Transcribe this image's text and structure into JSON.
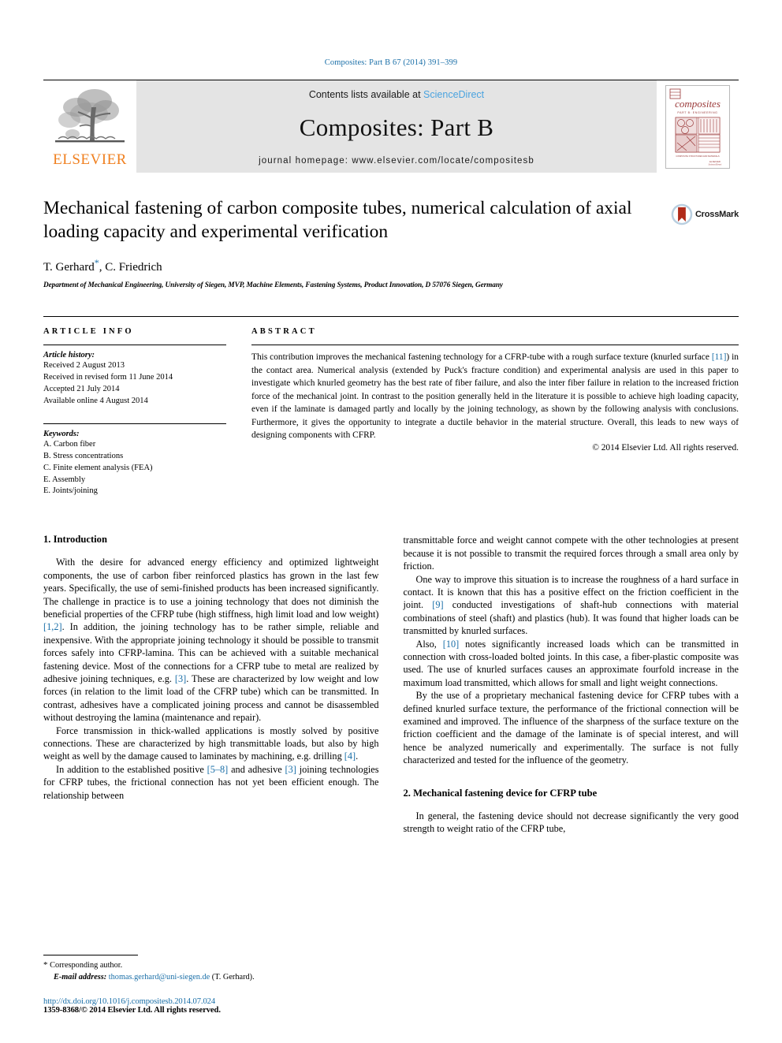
{
  "running_head": "Composites: Part B 67 (2014) 391–399",
  "masthead": {
    "publisher_name": "ELSEVIER",
    "contents_prefix": "Contents lists available at",
    "contents_link": "ScienceDirect",
    "journal_title": "Composites: Part B",
    "journal_homepage": "journal homepage: www.elsevier.com/locate/compositesb",
    "cover_title": "composites",
    "cover_subtitle": "PART B: ENGINEERING"
  },
  "article": {
    "title": "Mechanical fastening of carbon composite tubes, numerical calculation of axial loading capacity and experimental verification",
    "authors": "T. Gerhard",
    "authors_rest": ", C. Friedrich",
    "corresponding_marker": "*",
    "affiliation": "Department of Mechanical Engineering, University of Siegen, MVP, Machine Elements, Fastening Systems, Product Innovation, D 57076 Siegen, Germany",
    "crossmark_label": "CrossMark"
  },
  "article_info": {
    "heading": "ARTICLE INFO",
    "history_label": "Article history:",
    "history": [
      "Received 2 August 2013",
      "Received in revised form 11 June 2014",
      "Accepted 21 July 2014",
      "Available online 4 August 2014"
    ],
    "keywords_label": "Keywords:",
    "keywords": [
      "A. Carbon fiber",
      "B. Stress concentrations",
      "C. Finite element analysis (FEA)",
      "E. Assembly",
      "E. Joints/joining"
    ]
  },
  "abstract": {
    "heading": "ABSTRACT",
    "part1": "This contribution improves the mechanical fastening technology for a CFRP-tube with a rough surface texture (knurled surface ",
    "ref1": "[11]",
    "part2": ") in the contact area. Numerical analysis (extended by Puck's fracture condition) and experimental analysis are used in this paper to investigate which knurled geometry has the best rate of fiber failure, and also the inter fiber failure in relation to the increased friction force of the mechanical joint. In contrast to the position generally held in the literature it is possible to achieve high loading capacity, even if the laminate is damaged partly and locally by the joining technology, as shown by the following analysis with conclusions. Furthermore, it gives the opportunity to integrate a ductile behavior in the material structure. Overall, this leads to new ways of designing components with CFRP.",
    "copyright": "© 2014 Elsevier Ltd. All rights reserved."
  },
  "body": {
    "section1_title": "1. Introduction",
    "p1_a": "With the desire for advanced energy efficiency and optimized lightweight components, the use of carbon fiber reinforced plastics has grown in the last few years. Specifically, the use of semi-finished products has been increased significantly. The challenge in practice is to use a joining technology that does not diminish the beneficial properties of the CFRP tube (high stiffness, high limit load and low weight) ",
    "p1_ref1": "[1,2]",
    "p1_b": ". In addition, the joining technology has to be rather simple, reliable and inexpensive. With the appropriate joining technology it should be possible to transmit forces safely into CFRP-lamina. This can be achieved with a suitable mechanical fastening device. Most of the connections for a CFRP tube to metal are realized by adhesive joining techniques, e.g. ",
    "p1_ref2": "[3]",
    "p1_c": ". These are characterized by low weight and low forces (in relation to the limit load of the CFRP tube) which can be transmitted. In contrast, adhesives have a complicated joining process and cannot be disassembled without destroying the lamina (maintenance and repair).",
    "p2_a": "Force transmission in thick-walled applications is mostly solved by positive connections. These are characterized by high transmittable loads, but also by high weight as well by the damage caused to laminates by machining, e.g. drilling ",
    "p2_ref1": "[4]",
    "p2_b": ".",
    "p3_a": "In addition to the established positive ",
    "p3_ref1": "[5–8]",
    "p3_b": " and adhesive ",
    "p3_ref2": "[3]",
    "p3_c": " joining technologies for CFRP tubes, the frictional connection has not yet been efficient enough. The relationship between",
    "r_p1": "transmittable force and weight cannot compete with the other technologies at present because it is not possible to transmit the required forces through a small area only by friction.",
    "r_p2_a": "One way to improve this situation is to increase the roughness of a hard surface in contact. It is known that this has a positive effect on the friction coefficient in the joint. ",
    "r_p2_ref": "[9]",
    "r_p2_b": " conducted investigations of shaft-hub connections with material combinations of steel (shaft) and plastics (hub). It was found that higher loads can be transmitted by knurled surfaces.",
    "r_p3_a": "Also, ",
    "r_p3_ref": "[10]",
    "r_p3_b": " notes significantly increased loads which can be transmitted in connection with cross-loaded bolted joints. In this case, a fiber-plastic composite was used. The use of knurled surfaces causes an approximate fourfold increase in the maximum load transmitted, which allows for small and light weight connections.",
    "r_p4": "By the use of a proprietary mechanical fastening device for CFRP tubes with a defined knurled surface texture, the performance of the frictional connection will be examined and improved. The influence of the sharpness of the surface texture on the friction coefficient and the damage of the laminate is of special interest, and will hence be analyzed numerically and experimentally. The surface is not fully characterized and tested for the influence of the geometry.",
    "section2_title": "2. Mechanical fastening device for CFRP tube",
    "r_p5": "In general, the fastening device should not decrease significantly the very good strength to weight ratio of the CFRP tube,"
  },
  "footnotes": {
    "corresponding_marker": "*",
    "corresponding_label": "Corresponding author.",
    "email_label": "E-mail address:",
    "email": "thomas.gerhard@uni-siegen.de",
    "email_suffix": " (T. Gerhard).",
    "doi": "http://dx.doi.org/10.1016/j.compositesb.2014.07.024",
    "issn_line": "1359-8368/© 2014 Elsevier Ltd. All rights reserved."
  },
  "colors": {
    "link": "#1a6fa8",
    "sciencedirect": "#4aa3df",
    "elsevier_orange": "#f08020",
    "masthead_bg": "#e4e4e4",
    "crossmark_red": "#b02a19"
  }
}
